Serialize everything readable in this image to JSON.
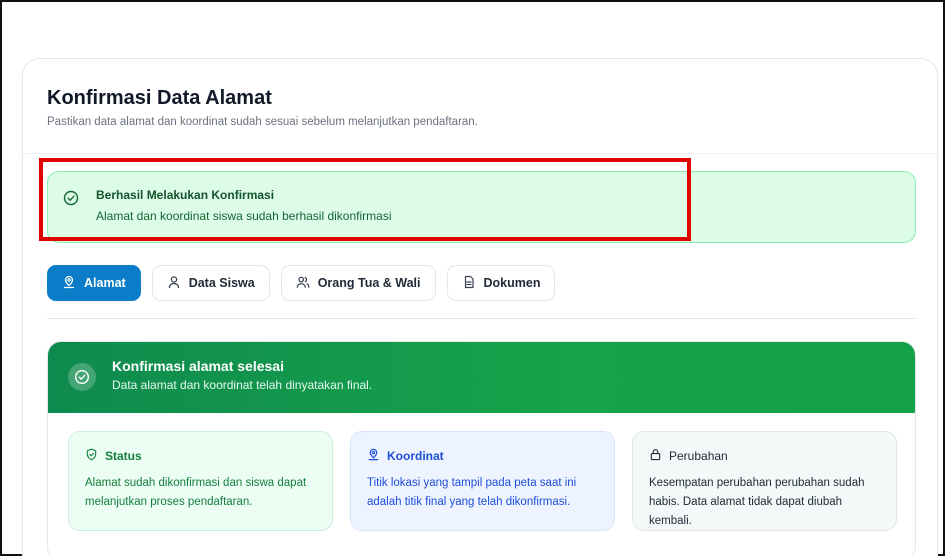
{
  "header": {
    "title": "Konfirmasi Data Alamat",
    "subtitle": "Pastikan data alamat dan koordinat sudah sesuai sebelum melanjutkan pendaftaran."
  },
  "alert": {
    "title": "Berhasil Melakukan Konfirmasi",
    "text": "Alamat dan koordinat siswa sudah berhasil dikonfirmasi",
    "icon": "check-circle-icon"
  },
  "tabs": [
    {
      "label": "Alamat",
      "icon": "map-pin-icon",
      "active": true
    },
    {
      "label": "Data Siswa",
      "icon": "user-icon",
      "active": false
    },
    {
      "label": "Orang Tua & Wali",
      "icon": "users-icon",
      "active": false
    },
    {
      "label": "Dokumen",
      "icon": "file-icon",
      "active": false
    }
  ],
  "panel": {
    "title": "Konfirmasi alamat selesai",
    "subtitle": "Data alamat dan koordinat telah dinyatakan final.",
    "boxes": [
      {
        "title": "Status",
        "icon": "shield-check-icon",
        "text": "Alamat sudah dikonfirmasi dan siswa dapat melanjutkan proses pendaftaran."
      },
      {
        "title": "Koordinat",
        "icon": "map-pin-icon",
        "text": "Titik lokasi yang tampil pada peta saat ini adalah titik final yang telah dikonfirmasi."
      },
      {
        "title": "Perubahan",
        "icon": "lock-icon",
        "text": "Kesempatan perubahan perubahan sudah habis. Data alamat tidak dapat diubah kembali."
      }
    ]
  },
  "colors": {
    "primary": "#0a7cc8",
    "success": "#16a34a",
    "highlight": "#e00000"
  }
}
